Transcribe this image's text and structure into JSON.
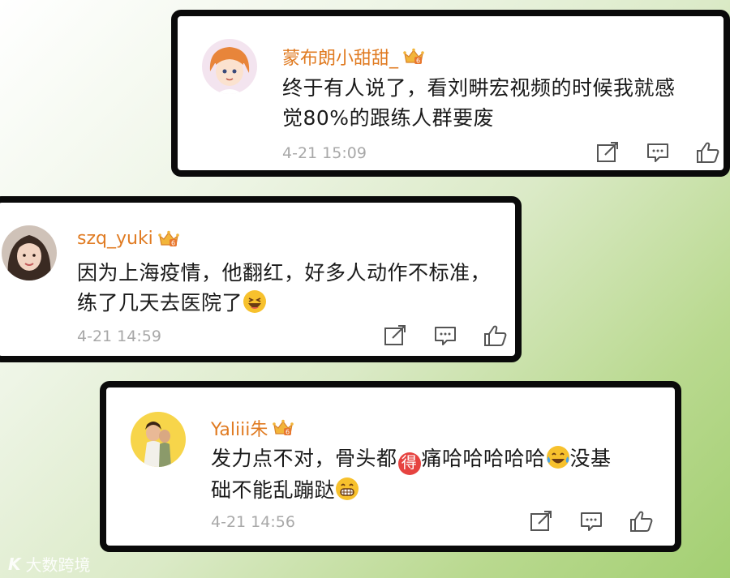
{
  "comments": [
    {
      "username": "蒙布朗小甜甜_",
      "content_line1": "终于有人说了，看刘畊宏视频的时候我就感",
      "content_line2": "觉80%的跟练人群要废",
      "timestamp": "4-21 15:09"
    },
    {
      "username": "szq_yuki",
      "content_line1": "因为上海疫情，他翻红，好多人动作不标准，",
      "content_line2": "练了几天去医院了",
      "timestamp": "4-21 14:59"
    },
    {
      "username": "Yaliii朱",
      "content_line1a": "发力点不对，骨头都",
      "badge_char": "得",
      "content_line1b": "痛哈哈哈哈哈",
      "content_line1c": "没基",
      "content_line2": "础不能乱蹦跶",
      "timestamp": "4-21 14:56"
    }
  ],
  "watermark": {
    "logo": "K",
    "text": "大数跨境"
  },
  "colors": {
    "username": "#e07b22",
    "timestamp": "#a8a8a8",
    "card_border": "#0a0a0a",
    "badge": "#e64340"
  },
  "icons": [
    "crown-badge-icon",
    "share-icon",
    "comment-icon",
    "like-icon",
    "laughing-emoji-icon",
    "tears-of-joy-emoji-icon",
    "grin-emoji-icon"
  ]
}
